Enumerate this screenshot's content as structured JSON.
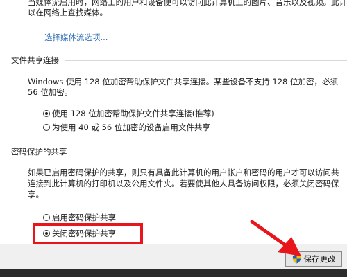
{
  "media": {
    "line1": "当媒体流启用时，网络上的用户和设备便可以访问此计算机上的图片、音乐以及视频。此计",
    "line2": "以在网络上查找媒体。",
    "link": "选择媒体流选项..."
  },
  "file_sharing": {
    "title": "文件共享连接",
    "desc1": "Windows 使用 128 位加密帮助保护文件共享连接。某些设备不支持 128 位加密，必须",
    "desc2": "56 位加密。",
    "option1": "使用 128 位加密帮助保护文件共享连接(推荐)",
    "option2": "为使用 40 或 56 位加密的设备启用文件共享"
  },
  "password_sharing": {
    "title": "密码保护的共享",
    "desc1": "如果已启用密码保护的共享，则只有具备此计算机的用户帐户和密码的用户才可以访问共",
    "desc2": "连接到此计算机的打印机以及公用文件夹。若要使其他人具备访问权限，必须关闭密码保",
    "desc3": "享。",
    "option1": "启用密码保护共享",
    "option2": "关闭密码保护共享"
  },
  "footer": {
    "save_label": "保存更改"
  },
  "colors": {
    "annotation": "#e8161b",
    "link": "#2e6db5"
  }
}
